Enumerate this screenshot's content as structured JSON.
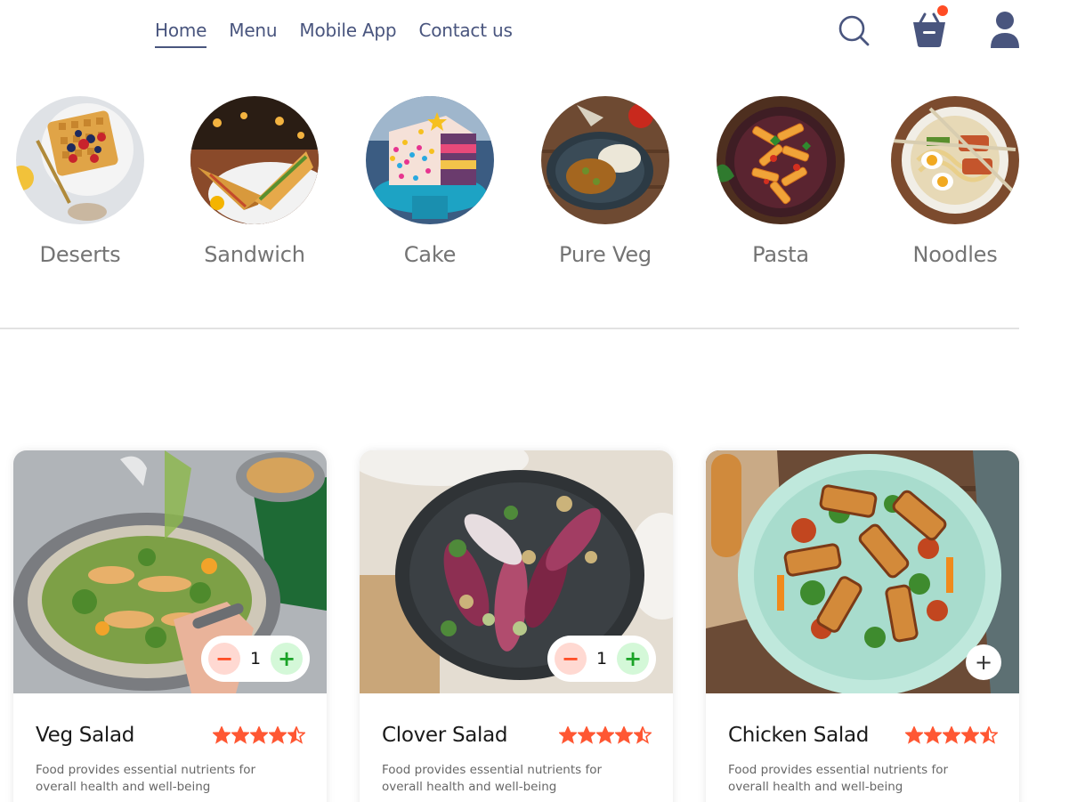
{
  "nav": {
    "links": [
      "Home",
      "Menu",
      "Mobile App",
      "Contact us"
    ],
    "active": "Home"
  },
  "header_icons": [
    "search-icon",
    "basket-icon",
    "profile-icon"
  ],
  "cart": {
    "has_items": true
  },
  "categories": [
    "Deserts",
    "Sandwich",
    "Cake",
    "Pure Veg",
    "Pasta",
    "Noodles"
  ],
  "foods": [
    {
      "name": "Veg Salad",
      "description": "Food provides essential nutrients for overall health and well-being",
      "rating": 4.5,
      "quantity": "1",
      "minus_symbol": "−",
      "plus_symbol": "+"
    },
    {
      "name": "Clover Salad",
      "description": "Food provides essential nutrients for overall health and well-being",
      "rating": 4.5,
      "quantity": "1",
      "minus_symbol": "−",
      "plus_symbol": "+"
    },
    {
      "name": "Chicken Salad",
      "description": "Food provides essential nutrients for overall health and well-being",
      "rating": 4.5,
      "add_symbol": "+"
    }
  ],
  "colors": {
    "nav_text": "#49557e",
    "accent": "#ff4c24",
    "star": "#ff5733",
    "minus_bg": "#ffd9d2",
    "plus_bg": "#d4f8d8",
    "plus_fg": "#1aa327"
  }
}
